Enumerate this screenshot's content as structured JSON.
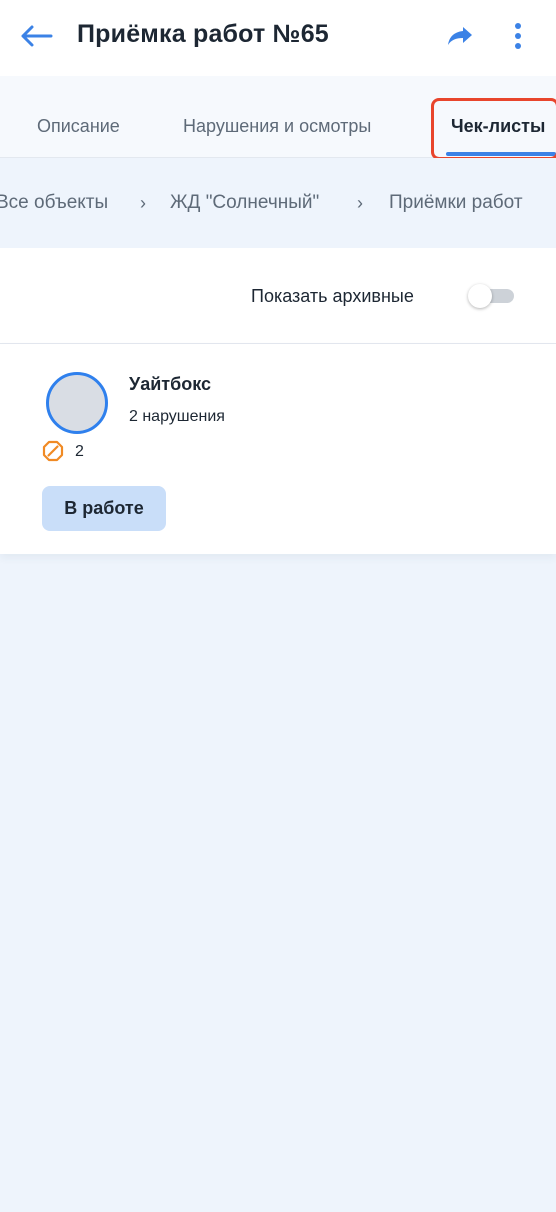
{
  "header": {
    "title": "Приёмка работ №65",
    "back_icon": "arrow-left-icon",
    "share_icon": "share-icon",
    "more_icon": "more-vertical-icon",
    "accent": "#3b82e6"
  },
  "tabs": [
    {
      "label": "Описание",
      "active": false
    },
    {
      "label": "Нарушения и осмотры",
      "active": false
    },
    {
      "label": "Чек-листы",
      "active": true
    }
  ],
  "breadcrumb": {
    "items": [
      "Все объекты",
      "ЖД \"Солнечный\"",
      "Приёмки работ"
    ],
    "separator": "›"
  },
  "archive": {
    "label": "Показать архивные",
    "enabled": false
  },
  "card": {
    "name": "Уайтбокс",
    "subtitle": "2 нарушения",
    "violation_icon": "prohibited-icon",
    "violation_count": "2",
    "status": "В работе",
    "status_color": "#c9def9"
  },
  "highlight_color": "#e8452c"
}
